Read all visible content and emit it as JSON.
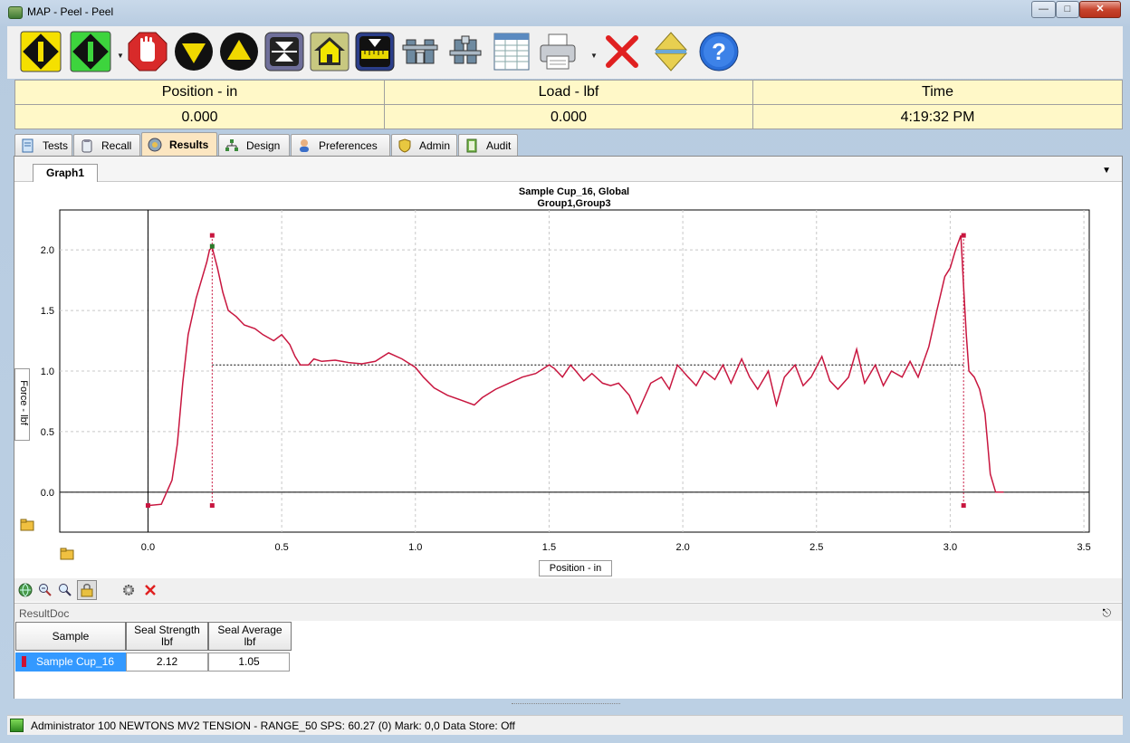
{
  "window": {
    "title": "MAP - Peel - Peel"
  },
  "toolbar": {
    "buttons": [
      {
        "name": "jog-down-icon"
      },
      {
        "name": "jog-up-icon"
      },
      {
        "name": "stop-hand-icon"
      },
      {
        "name": "down-arrow-icon"
      },
      {
        "name": "up-arrow-icon"
      },
      {
        "name": "zero-load-icon"
      },
      {
        "name": "home-icon"
      },
      {
        "name": "zero-position-icon"
      },
      {
        "name": "grip-open-icon"
      },
      {
        "name": "grip-close-icon"
      },
      {
        "name": "spreadsheet-icon"
      },
      {
        "name": "printer-icon"
      },
      {
        "name": "delete-icon"
      },
      {
        "name": "balance-icon"
      },
      {
        "name": "help-icon"
      }
    ]
  },
  "readouts": [
    {
      "label": "Position - in",
      "value": "0.000"
    },
    {
      "label": "Load - lbf",
      "value": "0.000"
    },
    {
      "label": "Time",
      "value": "4:19:32 PM"
    }
  ],
  "tabs": [
    {
      "label": "Tests",
      "active": false
    },
    {
      "label": "Recall",
      "active": false
    },
    {
      "label": "Results",
      "active": true
    },
    {
      "label": "Design",
      "active": false
    },
    {
      "label": "Preferences",
      "active": false
    },
    {
      "label": "Admin",
      "active": false
    },
    {
      "label": "Audit",
      "active": false
    }
  ],
  "graph": {
    "tab_label": "Graph1"
  },
  "chart_data": {
    "type": "line",
    "title": "Sample Cup_16, Global",
    "subtitle": "Group1,Group3",
    "xlabel": "Position - in",
    "ylabel": "Force - lbf",
    "xlim": [
      -0.33,
      3.52
    ],
    "ylim": [
      -0.33,
      2.33
    ],
    "xticks": [
      0.0,
      0.5,
      1.0,
      1.5,
      2.0,
      2.5,
      3.0,
      3.5
    ],
    "yticks": [
      0.0,
      0.5,
      1.0,
      1.5,
      2.0
    ],
    "xtick_labels": [
      "0.0",
      "0.5",
      "1.0",
      "1.5",
      "2.0",
      "2.5",
      "3.0",
      "3.5"
    ],
    "ytick_labels": [
      "0.0",
      "0.5",
      "1.0",
      "1.5",
      "2.0"
    ],
    "grid": true,
    "line_color": "#c8163f",
    "series": [
      {
        "x": [
          0.0,
          0.05,
          0.07,
          0.09,
          0.11,
          0.13,
          0.15,
          0.17,
          0.18,
          0.2,
          0.22,
          0.23,
          0.24,
          0.26,
          0.28,
          0.3,
          0.33,
          0.36,
          0.4,
          0.43,
          0.47,
          0.5,
          0.53,
          0.55,
          0.57,
          0.6,
          0.62,
          0.65,
          0.7,
          0.75,
          0.8,
          0.85,
          0.9,
          0.95,
          1.0,
          1.03,
          1.07,
          1.12,
          1.17,
          1.22,
          1.25,
          1.3,
          1.35,
          1.4,
          1.45,
          1.5,
          1.52,
          1.55,
          1.58,
          1.6,
          1.63,
          1.66,
          1.7,
          1.73,
          1.76,
          1.8,
          1.83,
          1.85,
          1.88,
          1.92,
          1.95,
          1.98,
          2.02,
          2.05,
          2.08,
          2.12,
          2.15,
          2.18,
          2.22,
          2.25,
          2.28,
          2.32,
          2.35,
          2.38,
          2.42,
          2.45,
          2.48,
          2.52,
          2.55,
          2.58,
          2.62,
          2.65,
          2.68,
          2.72,
          2.75,
          2.78,
          2.82,
          2.85,
          2.88,
          2.92,
          2.95,
          2.98,
          3.0,
          3.02,
          3.04,
          3.05,
          3.06,
          3.07,
          3.09,
          3.11,
          3.13,
          3.14,
          3.15,
          3.17,
          3.2
        ],
        "y": [
          -0.11,
          -0.1,
          0.0,
          0.1,
          0.4,
          0.9,
          1.3,
          1.5,
          1.6,
          1.75,
          1.9,
          2.0,
          2.02,
          1.85,
          1.65,
          1.5,
          1.45,
          1.38,
          1.35,
          1.3,
          1.25,
          1.3,
          1.22,
          1.12,
          1.05,
          1.05,
          1.1,
          1.08,
          1.09,
          1.07,
          1.06,
          1.08,
          1.15,
          1.1,
          1.03,
          0.95,
          0.86,
          0.8,
          0.76,
          0.72,
          0.78,
          0.85,
          0.9,
          0.95,
          0.98,
          1.05,
          1.02,
          0.95,
          1.05,
          1.0,
          0.92,
          0.98,
          0.9,
          0.88,
          0.9,
          0.8,
          0.65,
          0.75,
          0.9,
          0.95,
          0.85,
          1.05,
          0.95,
          0.88,
          1.0,
          0.93,
          1.05,
          0.9,
          1.1,
          0.95,
          0.85,
          1.0,
          0.72,
          0.95,
          1.05,
          0.88,
          0.95,
          1.12,
          0.92,
          0.85,
          0.95,
          1.18,
          0.9,
          1.05,
          0.88,
          1.0,
          0.95,
          1.08,
          0.95,
          1.2,
          1.5,
          1.78,
          1.85,
          2.0,
          2.12,
          1.7,
          1.3,
          1.0,
          0.95,
          0.85,
          0.65,
          0.4,
          0.15,
          0.0,
          0.0
        ]
      }
    ],
    "average_line": {
      "x0": 0.24,
      "x1": 3.05,
      "y": 1.05
    },
    "markers": [
      {
        "x": 0.0,
        "y": -0.11
      },
      {
        "x": 0.24,
        "y": 2.12
      },
      {
        "x": 0.24,
        "y": -0.11
      },
      {
        "x": 3.05,
        "y": 2.12
      },
      {
        "x": 3.05,
        "y": -0.11
      }
    ]
  },
  "chart_tools": [
    {
      "name": "globe-icon"
    },
    {
      "name": "zoom-out-icon"
    },
    {
      "name": "zoom-in-icon"
    },
    {
      "name": "lock-icon"
    },
    {
      "name": "settings-gear-icon"
    },
    {
      "name": "remove-icon"
    }
  ],
  "result_doc": {
    "title": "ResultDoc",
    "columns": [
      {
        "line1": "Sample",
        "line2": ""
      },
      {
        "line1": "Seal Strength",
        "line2": "lbf"
      },
      {
        "line1": "Seal Average",
        "line2": "lbf"
      }
    ],
    "rows": [
      {
        "sample": "Sample Cup_16",
        "seal_strength": "2.12",
        "seal_average": "1.05"
      }
    ]
  },
  "statusbar": {
    "text": "Administrator  100 NEWTONS MV2 TENSION - RANGE_50  SPS: 60.27 (0)  Mark: 0,0  Data Store: Off"
  }
}
